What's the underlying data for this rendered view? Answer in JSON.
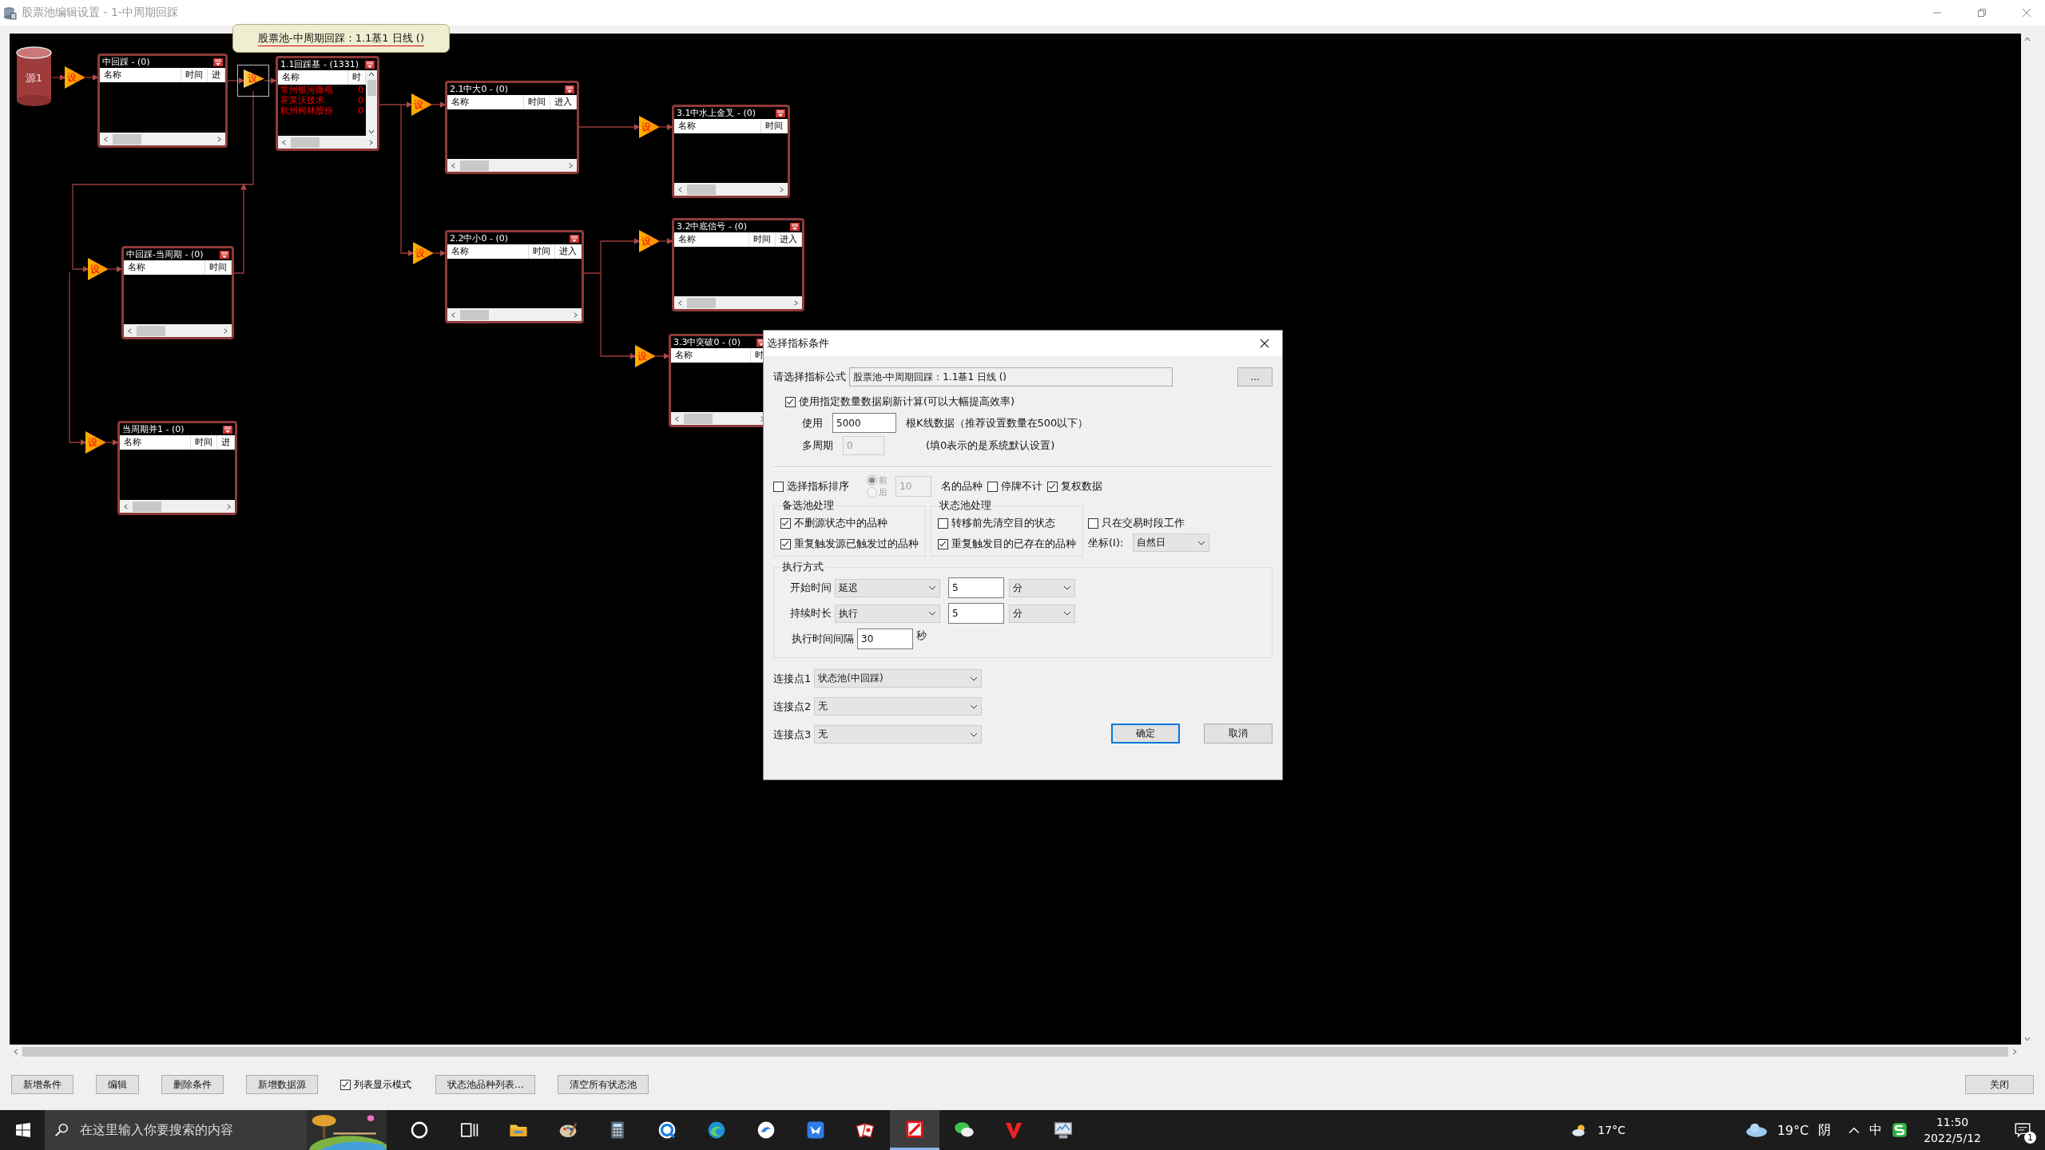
{
  "window": {
    "title": "股票池编辑设置 - 1-中周期回踩"
  },
  "canvas": {
    "source": {
      "label": "源1"
    },
    "tooltip": "股票池-中周期回踩：1.1基1 日线 ()",
    "triggers": [
      {
        "label": "设",
        "selected": false
      },
      {
        "label": "设",
        "selected": true
      },
      {
        "label": "设",
        "selected": false
      },
      {
        "label": "设",
        "selected": false
      },
      {
        "label": "设",
        "selected": false
      },
      {
        "label": "设",
        "selected": false
      },
      {
        "label": "设",
        "selected": false
      },
      {
        "label": "设",
        "selected": false
      },
      {
        "label": "设",
        "selected": false
      }
    ],
    "nodes": [
      {
        "title": "中回踩 - (0)",
        "columns": [
          "名称",
          "时间",
          "进"
        ]
      },
      {
        "title": "1.1回踩基 - (1331)",
        "columns": [
          "名称",
          "时"
        ],
        "rows": [
          {
            "name": "常州银河微电",
            "value": "0"
          },
          {
            "name": "霍莱沃技术",
            "value": "0"
          },
          {
            "name": "杭州柯林股份",
            "value": "0"
          }
        ]
      },
      {
        "title": "2.1中大0 - (0)",
        "columns": [
          "名称",
          "时间",
          "进入"
        ]
      },
      {
        "title": "3.1中水上金叉 - (0)",
        "columns": [
          "名称",
          "时间"
        ]
      },
      {
        "title": "3.2中底信号 - (0)",
        "columns": [
          "名称",
          "时间",
          "进入"
        ]
      },
      {
        "title": "2.2中小0 - (0)",
        "columns": [
          "名称",
          "时间",
          "进入"
        ]
      },
      {
        "title": "3.3中突破0 - (0)",
        "columns": [
          "名称",
          "时"
        ]
      },
      {
        "title": "中回踩-当周期 - (0)",
        "columns": [
          "名称",
          "时间"
        ]
      },
      {
        "title": "当周期并1 - (0)",
        "columns": [
          "名称",
          "时间",
          "进"
        ]
      }
    ]
  },
  "dialog": {
    "title": "选择指标条件",
    "formula": {
      "label": "请选择指标公式",
      "value": "股票池-中周期回踩：1.1基1 日线 ()",
      "browse": "..."
    },
    "use_count": {
      "label": "使用指定数量数据刷新计算(可以大幅提高效率)",
      "checked": true
    },
    "use": {
      "label": "使用",
      "value": "5000",
      "suffix": "根K线数据（推荐设置数量在500以下）"
    },
    "multi_period": {
      "label": "多周期",
      "value": "0",
      "disabled": true,
      "hint": "(填0表示的是系统默认设置)"
    },
    "sort": {
      "label": "选择指标排序",
      "checked": false,
      "radios": [
        {
          "label": "前",
          "selected": true
        },
        {
          "label": "后",
          "selected": false
        }
      ],
      "count": "10",
      "suffix": "名的品种"
    },
    "suspend": {
      "label": "停牌不计",
      "checked": false
    },
    "adjust": {
      "label": "复权数据",
      "checked": true
    },
    "candidate_group": {
      "title": "备选池处理",
      "options": [
        {
          "label": "不删源状态中的品种",
          "checked": true
        },
        {
          "label": "重复触发源已触发过的品种",
          "checked": true
        }
      ]
    },
    "state_group": {
      "title": "状态池处理",
      "options": [
        {
          "label": "转移前先清空目的状态",
          "checked": false
        },
        {
          "label": "重复触发目的已存在的品种",
          "checked": true
        }
      ]
    },
    "trading_only": {
      "label": "只在交易时段工作",
      "checked": false
    },
    "axis": {
      "label": "坐标(I):",
      "value": "自然日"
    },
    "exec": {
      "title": "执行方式",
      "rows": [
        {
          "label": "开始时间",
          "mode": "延迟",
          "value": "5",
          "unit": "分"
        },
        {
          "label": "持续时长",
          "mode": "执行",
          "value": "5",
          "unit": "分"
        }
      ],
      "interval": {
        "label": "执行时间间隔",
        "value": "30",
        "unit": "秒"
      }
    },
    "connections": [
      {
        "label": "连接点1",
        "value": "状态池(中回踩)"
      },
      {
        "label": "连接点2",
        "value": "无"
      },
      {
        "label": "连接点3",
        "value": "无"
      }
    ],
    "buttons": [
      {
        "label": "确定",
        "default": true
      },
      {
        "label": "取消",
        "default": false
      }
    ]
  },
  "toolbar": {
    "items": [
      {
        "kind": "button",
        "label": "新增条件"
      },
      {
        "kind": "button",
        "label": "编辑"
      },
      {
        "kind": "button",
        "label": "删除条件"
      },
      {
        "kind": "button",
        "label": "新增数据源"
      },
      {
        "kind": "checkbox",
        "label": "列表显示模式",
        "checked": true
      },
      {
        "kind": "button",
        "label": "状态池品种列表..."
      },
      {
        "kind": "button",
        "label": "清空所有状态池"
      }
    ],
    "close": "关闭"
  },
  "taskbar": {
    "search": {
      "placeholder": "在这里输入你要搜索的内容"
    },
    "apps": [
      {
        "kind": "circle",
        "active": false
      },
      {
        "kind": "taskview",
        "active": false
      },
      {
        "kind": "folder",
        "active": false
      },
      {
        "kind": "palette",
        "active": false
      },
      {
        "kind": "calculator",
        "active": false
      },
      {
        "kind": "q",
        "active": false
      },
      {
        "kind": "browser",
        "active": false
      },
      {
        "kind": "bluecircle",
        "active": false
      },
      {
        "kind": "bird",
        "active": false
      },
      {
        "kind": "cards",
        "active": false
      },
      {
        "kind": "redsquare",
        "active": true
      },
      {
        "kind": "chat",
        "active": false
      },
      {
        "kind": "v",
        "active": false
      },
      {
        "kind": "monitor",
        "active": false
      }
    ],
    "weather_left": "17°C",
    "weather_temp": "19°C",
    "weather_text": "阴",
    "ime": "中",
    "time": "11:50",
    "date": "2022/5/12",
    "notifications": "1"
  }
}
